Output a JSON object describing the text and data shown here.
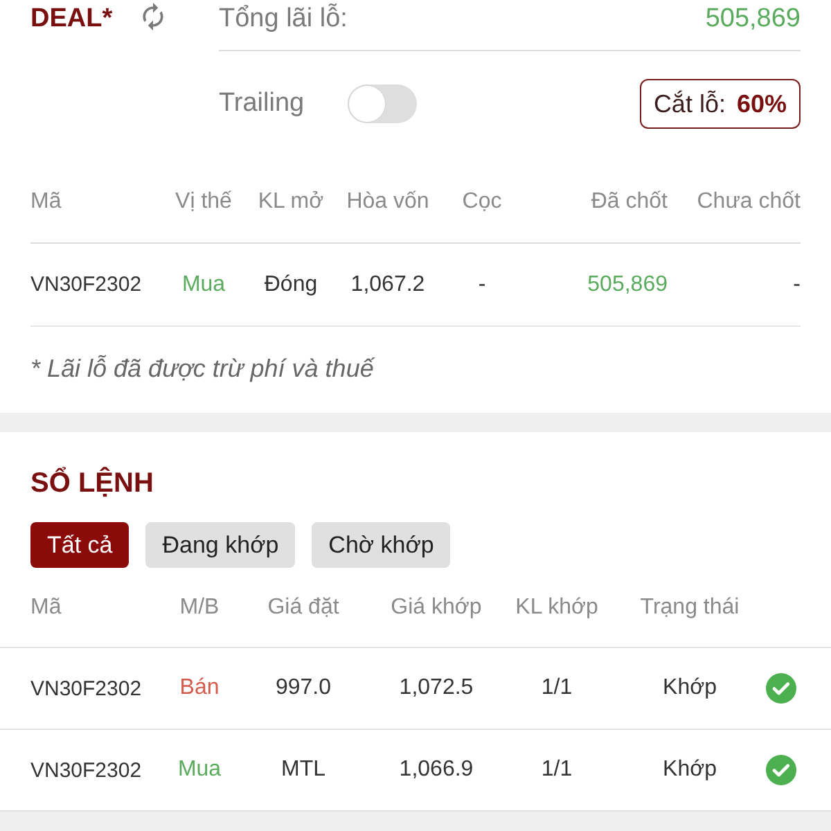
{
  "deal": {
    "title": "DEAL*",
    "total": {
      "label": "Tổng lãi lỗ:",
      "value": "505,869",
      "profit": true
    },
    "trailing": {
      "label": "Trailing",
      "on": false
    },
    "stop_loss": {
      "label": "Cắt lỗ:",
      "value": "60%"
    },
    "table": {
      "columns": [
        "Mã",
        "Vị thế",
        "KL mở",
        "Hòa vốn",
        "Cọc",
        "Đã chốt",
        "Chưa chốt"
      ],
      "rows": [
        {
          "symbol": "VN30F2302",
          "position": {
            "text": "Mua",
            "color": "#5aab5e"
          },
          "open_volume": "Đóng",
          "breakeven": "1,067.2",
          "deposit": "-",
          "closed": "505,869",
          "closed_profit": true,
          "unclosed": "-"
        }
      ]
    },
    "note": "* Lãi lỗ đã được trừ phí và thuế"
  },
  "order_book": {
    "title": "SỔ LỆNH",
    "filters": [
      {
        "label": "Tất cả",
        "selected": true
      },
      {
        "label": "Đang khớp",
        "selected": false
      },
      {
        "label": "Chờ khớp",
        "selected": false
      }
    ],
    "table": {
      "columns": [
        "Mã",
        "M/B",
        "Giá đặt",
        "Giá khớp",
        "KL khớp",
        "Trạng thái"
      ],
      "rows": [
        {
          "symbol": "VN30F2302",
          "side": {
            "text": "Bán",
            "color": "#d35b4c"
          },
          "price": "997.0",
          "matched_price": "1,072.5",
          "matched_volume": "1/1",
          "status": "Khớp",
          "matched": true
        },
        {
          "symbol": "VN30F2302",
          "side": {
            "text": "Mua",
            "color": "#5aab5e"
          },
          "price": "MTL",
          "matched_price": "1,066.9",
          "matched_volume": "1/1",
          "status": "Khớp",
          "matched": true
        }
      ]
    }
  }
}
